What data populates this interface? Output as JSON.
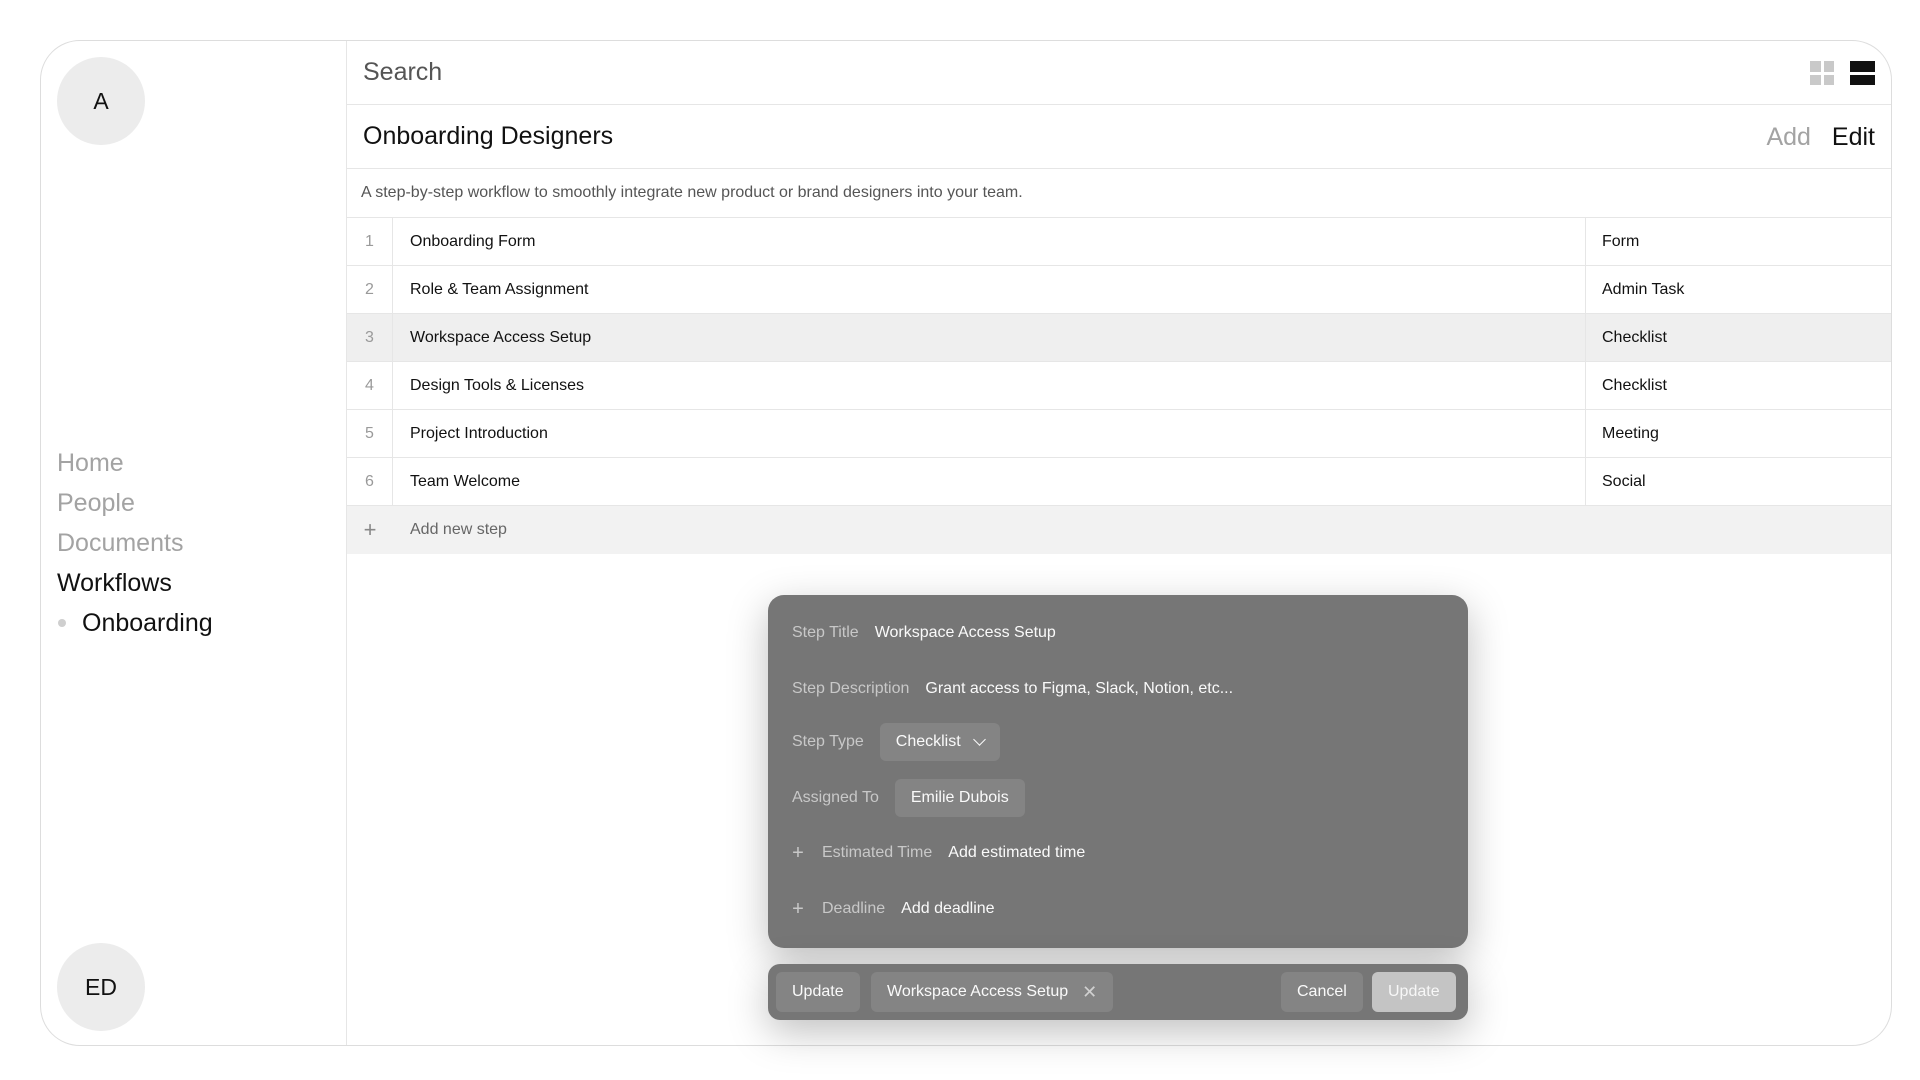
{
  "sidebar": {
    "top_avatar": "A",
    "bottom_avatar": "ED",
    "nav": [
      "Home",
      "People",
      "Documents"
    ],
    "active_nav": "Workflows",
    "sub_nav": "Onboarding"
  },
  "search": {
    "placeholder": "Search"
  },
  "header": {
    "title": "Onboarding Designers",
    "add_label": "Add",
    "edit_label": "Edit"
  },
  "description": "A step-by-step workflow to smoothly integrate new product or brand designers into your team.",
  "steps": [
    {
      "num": "1",
      "name": "Onboarding Form",
      "type": "Form"
    },
    {
      "num": "2",
      "name": "Role & Team Assignment",
      "type": "Admin Task"
    },
    {
      "num": "3",
      "name": "Workspace Access Setup",
      "type": "Checklist"
    },
    {
      "num": "4",
      "name": "Design Tools & Licenses",
      "type": "Checklist"
    },
    {
      "num": "5",
      "name": "Project Introduction",
      "type": "Meeting"
    },
    {
      "num": "6",
      "name": "Team Welcome",
      "type": "Social"
    }
  ],
  "add_step": {
    "icon": "+",
    "label": "Add new step"
  },
  "modal": {
    "step_title_label": "Step Title",
    "step_title_value": "Workspace Access Setup",
    "step_desc_label": "Step Description",
    "step_desc_value": "Grant access to Figma, Slack, Notion, etc...",
    "step_type_label": "Step Type",
    "step_type_value": "Checklist",
    "assigned_label": "Assigned To",
    "assigned_value": "Emilie Dubois",
    "est_time_label": "Estimated Time",
    "est_time_value": "Add estimated time",
    "deadline_label": "Deadline",
    "deadline_value": "Add deadline",
    "plus": "+"
  },
  "bottombar": {
    "mode_label": "Update",
    "tag_label": "Workspace Access Setup",
    "tag_close": "✕",
    "cancel_label": "Cancel",
    "update_label": "Update"
  }
}
